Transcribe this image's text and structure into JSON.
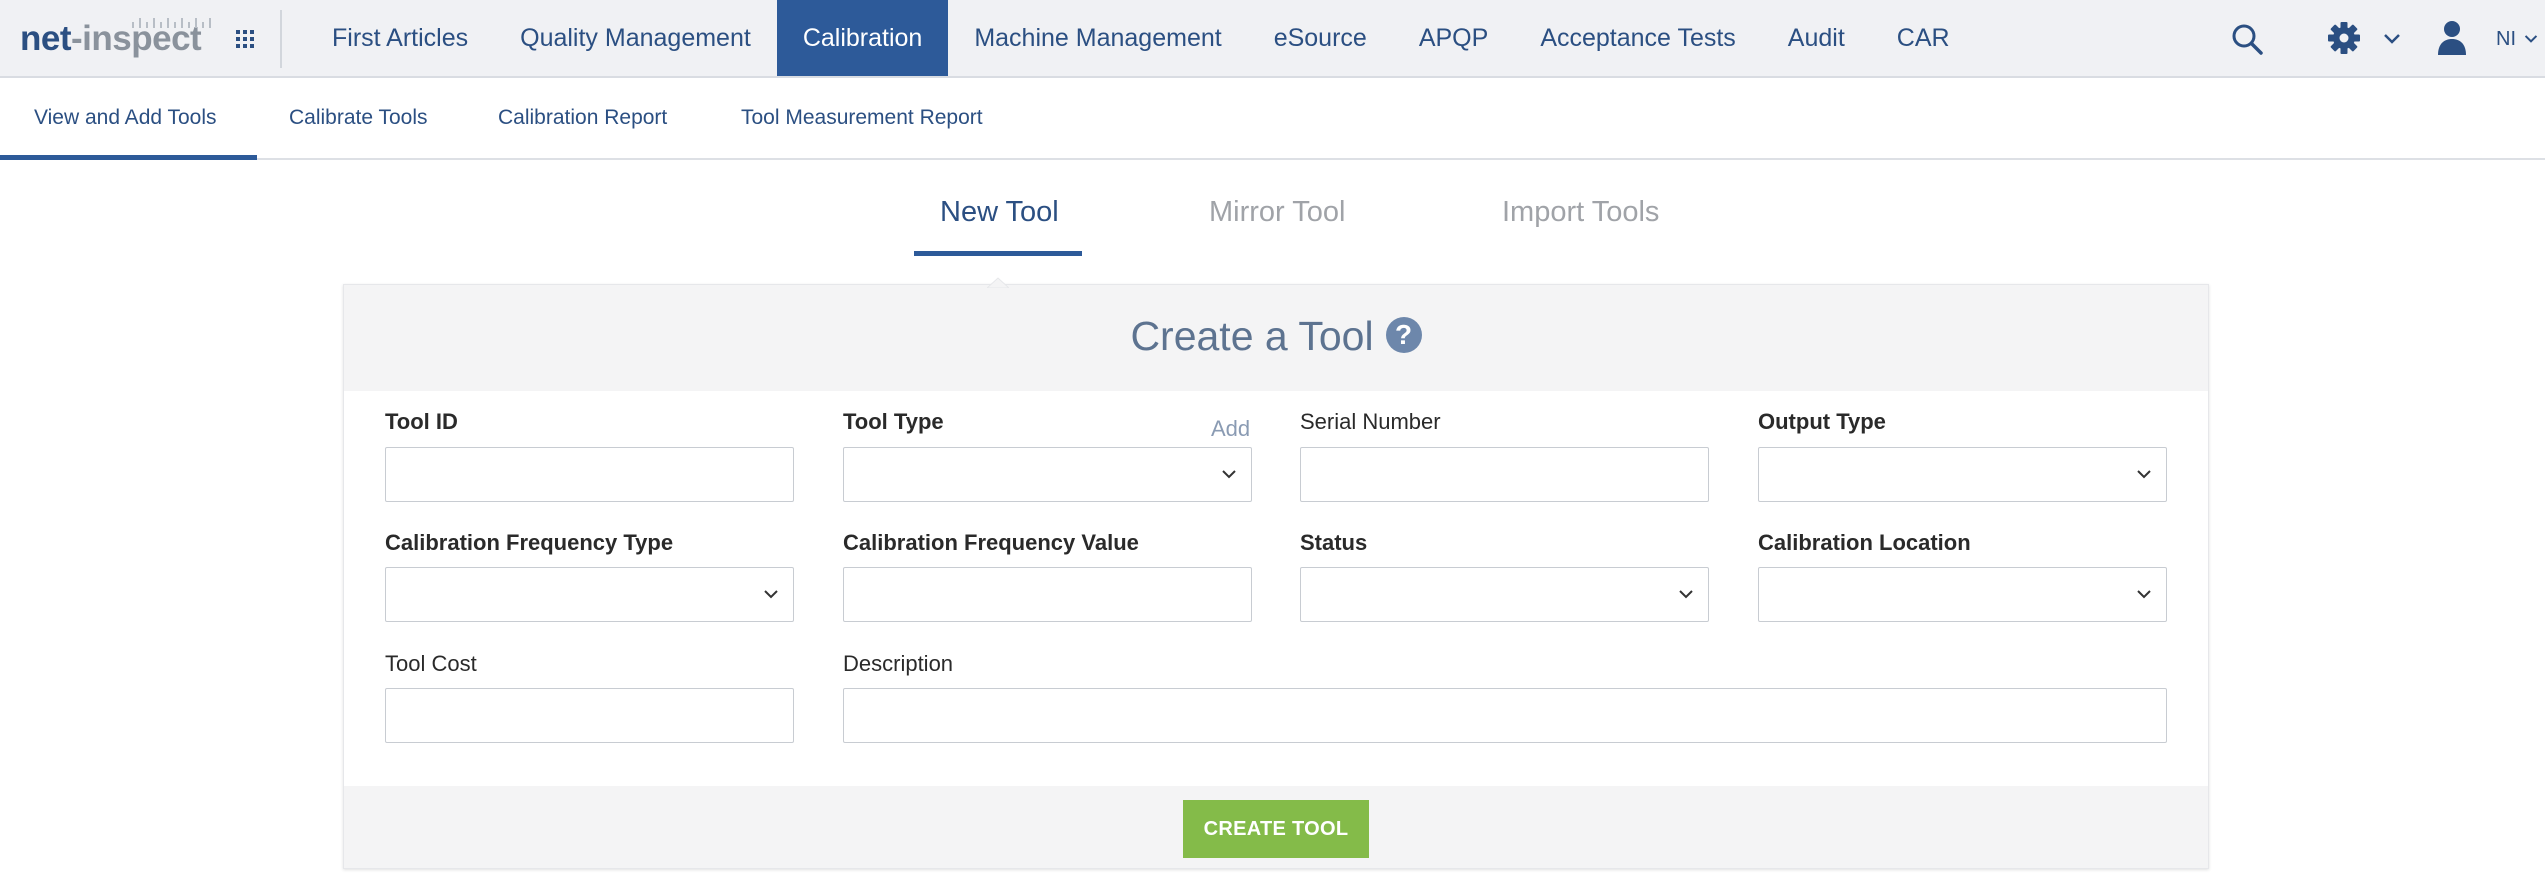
{
  "brand": {
    "logo_net": "net",
    "logo_dash": "-",
    "logo_inspect": "inspect"
  },
  "topnav": {
    "items": [
      {
        "label": "First Articles",
        "active": false
      },
      {
        "label": "Quality Management",
        "active": false
      },
      {
        "label": "Calibration",
        "active": true
      },
      {
        "label": "Machine Management",
        "active": false
      },
      {
        "label": "eSource",
        "active": false
      },
      {
        "label": "APQP",
        "active": false
      },
      {
        "label": "Acceptance Tests",
        "active": false
      },
      {
        "label": "Audit",
        "active": false
      },
      {
        "label": "CAR",
        "active": false
      }
    ],
    "user_initials": "NI",
    "icons": [
      "apps-grid-icon",
      "search-icon",
      "gear-icon",
      "chevron-down-icon",
      "user-icon"
    ]
  },
  "subnav": {
    "tabs": [
      {
        "label": "View and Add Tools",
        "active": true
      },
      {
        "label": "Calibrate Tools",
        "active": false
      },
      {
        "label": "Calibration Report",
        "active": false
      },
      {
        "label": "Tool Measurement Report",
        "active": false
      }
    ]
  },
  "mode_tabs": [
    {
      "label": "New Tool",
      "active": true
    },
    {
      "label": "Mirror Tool",
      "active": false
    },
    {
      "label": "Import Tools",
      "active": false
    }
  ],
  "form": {
    "title": "Create a Tool",
    "help_symbol": "?",
    "add_link": "Add",
    "fields": {
      "tool_id": {
        "label": "Tool ID",
        "value": ""
      },
      "tool_type": {
        "label": "Tool Type",
        "value": ""
      },
      "serial_number": {
        "label": "Serial Number",
        "value": ""
      },
      "output_type": {
        "label": "Output Type",
        "value": ""
      },
      "cal_freq_type": {
        "label": "Calibration Frequency Type",
        "value": ""
      },
      "cal_freq_value": {
        "label": "Calibration Frequency Value",
        "value": ""
      },
      "status": {
        "label": "Status",
        "value": ""
      },
      "cal_location": {
        "label": "Calibration Location",
        "value": ""
      },
      "tool_cost": {
        "label": "Tool Cost",
        "value": ""
      },
      "description": {
        "label": "Description",
        "value": ""
      }
    },
    "submit_label": "CREATE TOOL"
  },
  "colors": {
    "brand_blue": "#2d5a99",
    "active_nav_bg": "#2d5a99",
    "create_button": "#84bb49",
    "inactive_tab_text": "#a0a3a8"
  }
}
